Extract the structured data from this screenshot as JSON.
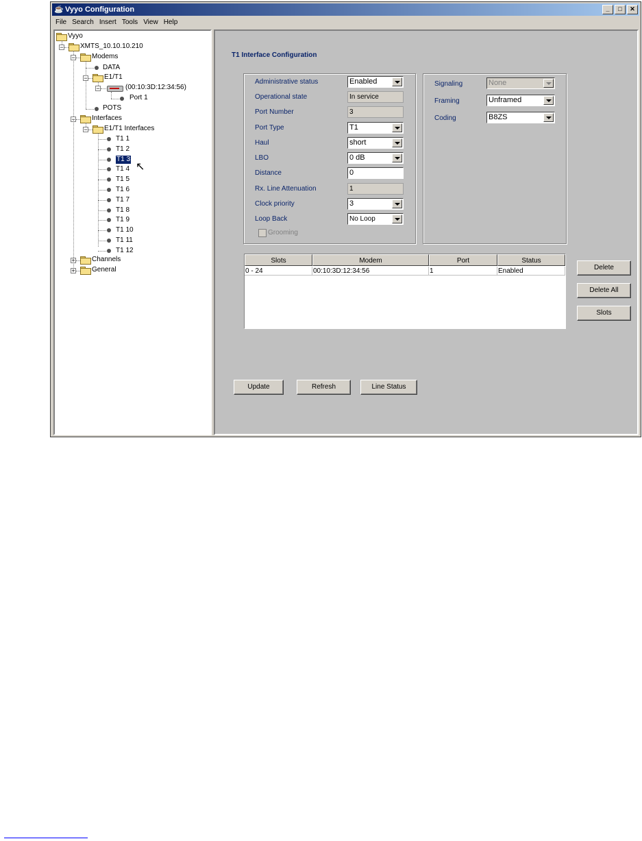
{
  "window": {
    "title": "Vyyo Configuration"
  },
  "menu": [
    "File",
    "Search",
    "Insert",
    "Tools",
    "View",
    "Help"
  ],
  "tree": {
    "root": "Vyyo",
    "host": "XMTS_10.10.10.210",
    "modems": "Modems",
    "data": "DATA",
    "e1t1": "E1/T1",
    "modem_mac": "(00:10:3D:12:34:56)",
    "port": "Port 1",
    "pots": "POTS",
    "interfaces": "Interfaces",
    "e1t1_interfaces": "E1/T1 Interfaces",
    "t1_items": [
      "T1 1",
      "T1 2",
      "T1 3",
      "T1 4",
      "T1 5",
      "T1 6",
      "T1 7",
      "T1 8",
      "T1 9",
      "T1 10",
      "T1 11",
      "T1 12"
    ],
    "selected_index": 2,
    "channels": "Channels",
    "general": "General"
  },
  "panel": {
    "title": "T1 Interface Configuration",
    "left_fields": {
      "admin_status": {
        "label": "Administrative status",
        "value": "Enabled"
      },
      "oper_state": {
        "label": "Operational state",
        "value": "In service"
      },
      "port_number": {
        "label": "Port Number",
        "value": "3"
      },
      "port_type": {
        "label": "Port Type",
        "value": "T1"
      },
      "haul": {
        "label": "Haul",
        "value": "short"
      },
      "lbo": {
        "label": "LBO",
        "value": "0 dB"
      },
      "distance": {
        "label": "Distance",
        "value": "0"
      },
      "rx_attenuation": {
        "label": "Rx. Line  Attenuation",
        "value": "1"
      },
      "clock_priority": {
        "label": "Clock priority",
        "value": "3"
      },
      "loop_back": {
        "label": "Loop Back",
        "value": "No Loop"
      },
      "grooming": {
        "label": "Grooming"
      }
    },
    "right_fields": {
      "signaling": {
        "label": "Signaling",
        "value": "None"
      },
      "framing": {
        "label": "Framing",
        "value": "Unframed"
      },
      "coding": {
        "label": "Coding",
        "value": "B8ZS"
      }
    },
    "table": {
      "headers": [
        "Slots",
        "Modem",
        "Port",
        "Status"
      ],
      "rows": [
        [
          "0 - 24",
          "00:10:3D:12:34:56",
          "1",
          "Enabled"
        ]
      ]
    },
    "side_buttons": {
      "delete": "Delete",
      "delete_all": "Delete All",
      "slots": "Slots"
    },
    "bottom_buttons": {
      "update": "Update",
      "refresh": "Refresh",
      "line_status": "Line Status"
    }
  }
}
